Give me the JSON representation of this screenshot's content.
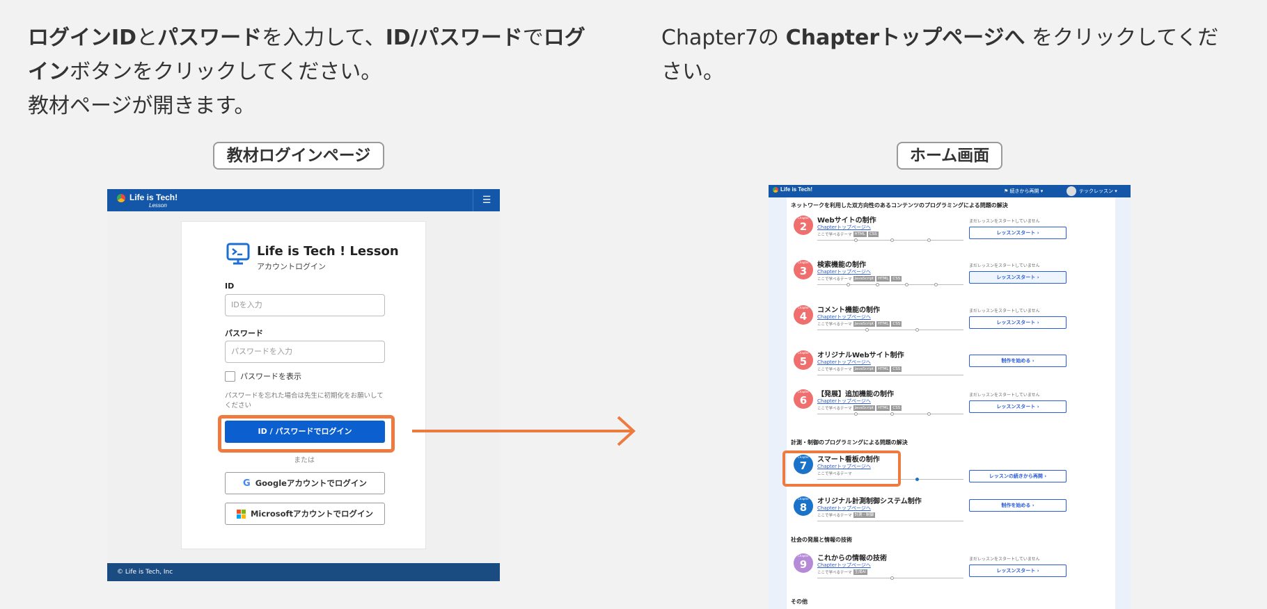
{
  "instructions": {
    "left": {
      "line1": [
        {
          "text": "ログインID",
          "bold": true
        },
        {
          "text": "と",
          "bold": false
        },
        {
          "text": "パスワード",
          "bold": true
        },
        {
          "text": "を入力して、",
          "bold": false
        },
        {
          "text": "ID/パスワード",
          "bold": true
        },
        {
          "text": "で",
          "bold": false
        },
        {
          "text": "ログイン",
          "bold": true
        },
        {
          "text": "ボタンをクリックしてください。",
          "bold": false
        }
      ],
      "line2": "教材ページが開きます。"
    },
    "right": [
      {
        "text": "Chapter7の ",
        "bold": false
      },
      {
        "text": "Chapterトップページへ",
        "bold": true
      },
      {
        "text": " をクリックしてください。",
        "bold": false
      }
    ]
  },
  "captions": {
    "left": "教材ログインページ",
    "right": "ホーム画面"
  },
  "login": {
    "logo": "Life is Tech!",
    "logo_sub": "Lesson",
    "brand_title": "Life is Tech ! Lesson",
    "brand_sub": "アカウントログイン",
    "id_label": "ID",
    "id_placeholder": "IDを入力",
    "pw_label": "パスワード",
    "pw_placeholder": "パスワードを入力",
    "show_pw": "パスワードを表示",
    "forgot_note": "パスワードを忘れた場合は先生に初期化をお願いしてください",
    "login_button": "ID / パスワードでログイン",
    "or": "または",
    "google_button": "Googleアカウントでログイン",
    "microsoft_button": "Microsoftアカウントでログイン",
    "footer": "© Life is Tech, Inc"
  },
  "home": {
    "logo": "Life is Tech!",
    "resume": "続きから再開 ▾",
    "user": "テックレッスン ▾",
    "sections": [
      "ネットワークを利用した双方向性のあるコンテンツのプログラミングによる問題の解決",
      "計測・制御のプログラミングによる問題の解決",
      "社会の発展と情報の技術",
      "その他"
    ],
    "chapter_label": "Chapter",
    "link_text": "Chapterトップページへ",
    "theme_prefix": "ここで学べるテーマ",
    "chapters": [
      {
        "num": "2",
        "title": "Webサイトの制作",
        "tags": [
          "HTML",
          "CSS"
        ],
        "status": "まだレッスンをスタートしていません",
        "button": "レッスンスタート ›",
        "color": "#ef6f6f"
      },
      {
        "num": "3",
        "title": "検索機能の制作",
        "tags": [
          "JavaScript",
          "HTML",
          "CSS"
        ],
        "status": "まだレッスンをスタートしていません",
        "button": "レッスンスタート ›",
        "color": "#ef6f6f"
      },
      {
        "num": "4",
        "title": "コメント機能の制作",
        "tags": [
          "JavaScript",
          "HTML",
          "CSS"
        ],
        "status": "まだレッスンをスタートしていません",
        "button": "レッスンスタート ›",
        "color": "#ef6f6f"
      },
      {
        "num": "5",
        "title": "オリジナルWebサイト制作",
        "tags": [
          "JavaScript",
          "HTML",
          "CSS"
        ],
        "status": "",
        "button": "制作を始める ›",
        "color": "#ef6f6f"
      },
      {
        "num": "6",
        "title": "【発展】追加機能の制作",
        "tags": [
          "JavaScript",
          "HTML",
          "CSS"
        ],
        "status": "まだレッスンをスタートしていません",
        "button": "レッスンスタート ›",
        "color": "#ef6f6f"
      },
      {
        "num": "7",
        "title": "スマート看板の制作",
        "tags": [],
        "status": "",
        "button": "レッスンの続きから再開 ›",
        "color": "#1a73c8"
      },
      {
        "num": "8",
        "title": "オリジナル計測制御システム制作",
        "tags": [
          "計測・制御"
        ],
        "status": "",
        "button": "制作を始める ›",
        "color": "#1a73c8"
      },
      {
        "num": "9",
        "title": "これからの情報の技術",
        "tags": [
          "生成AI"
        ],
        "status": "まだレッスンをスタートしていません",
        "button": "レッスンスタート ›",
        "color": "#b58ad6"
      }
    ]
  }
}
